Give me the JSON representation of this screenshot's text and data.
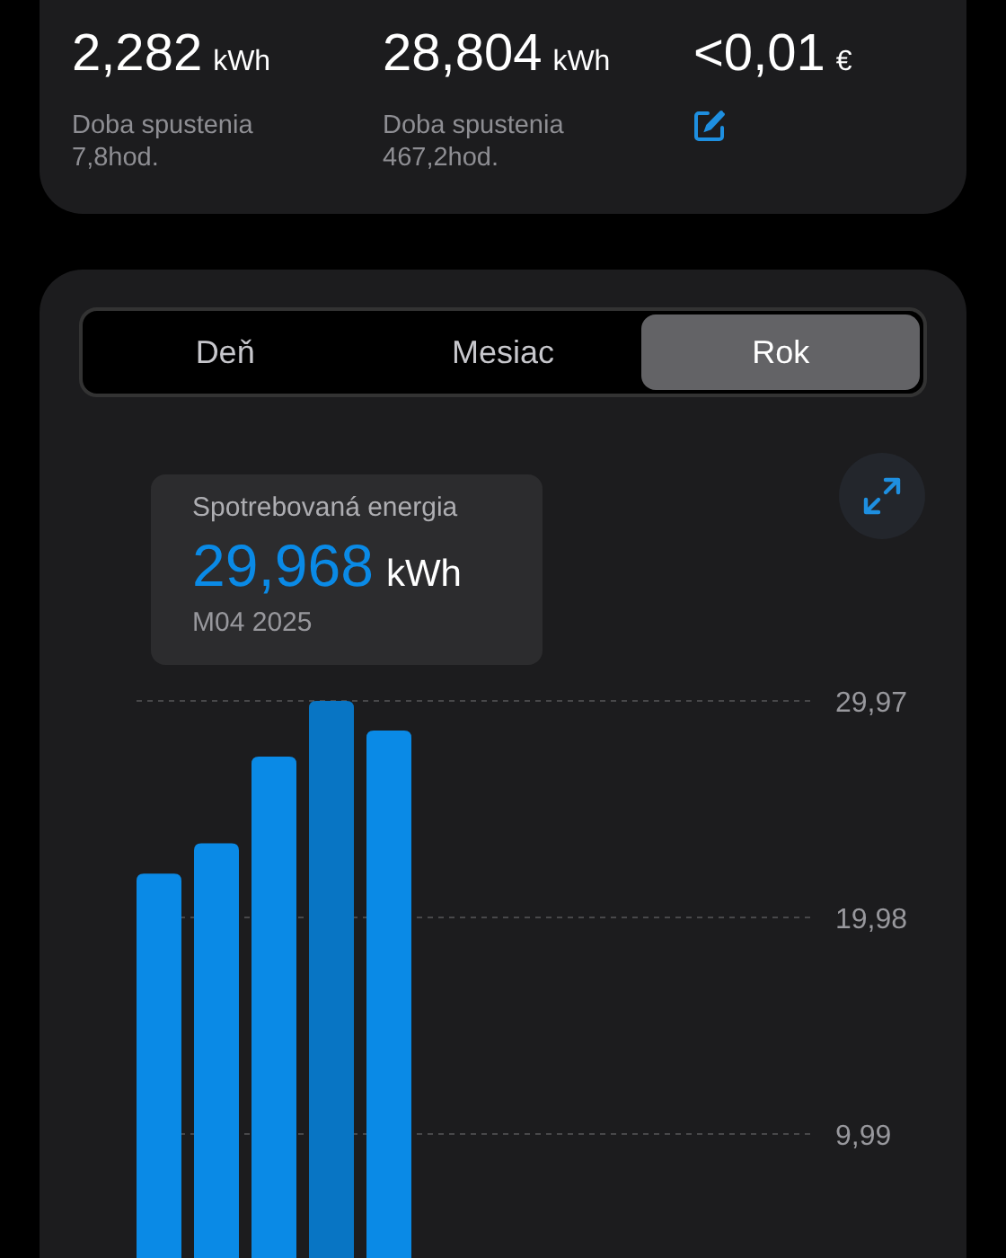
{
  "summary": {
    "stats": [
      {
        "value": "2,282",
        "unit": "kWh",
        "label": "Doba spustenia",
        "detail": "7,8hod.",
        "kind": "runtime"
      },
      {
        "value": "28,804",
        "unit": "kWh",
        "label": "Doba spustenia",
        "detail": "467,2hod.",
        "kind": "runtime"
      },
      {
        "value": "<0,01",
        "unit": "€",
        "kind": "cost"
      }
    ]
  },
  "period_tabs": [
    {
      "label": "Deň",
      "selected": false
    },
    {
      "label": "Mesiac",
      "selected": false
    },
    {
      "label": "Rok",
      "selected": true
    }
  ],
  "tooltip": {
    "title": "Spotrebovaná energia",
    "value": "29,968",
    "unit": "kWh",
    "period": "M04 2025"
  },
  "chart": {
    "bars": [
      {
        "selected": false
      },
      {
        "selected": false
      },
      {
        "selected": false
      },
      {
        "selected": true
      },
      {
        "selected": false
      }
    ],
    "chart_data": {
      "type": "bar",
      "ylim": [
        0,
        29.97
      ],
      "series": [
        {
          "color": "#0a8ae6",
          "values": [
            22.0,
            23.4,
            27.4,
            29.97,
            28.6,
            null,
            null,
            null,
            null,
            null,
            null,
            null
          ]
        }
      ],
      "yticks": [
        {
          "value": 9.99,
          "label": "9,99"
        },
        {
          "value": 19.98,
          "label": "19,98"
        },
        {
          "value": 29.97,
          "label": "29,97"
        }
      ]
    }
  }
}
